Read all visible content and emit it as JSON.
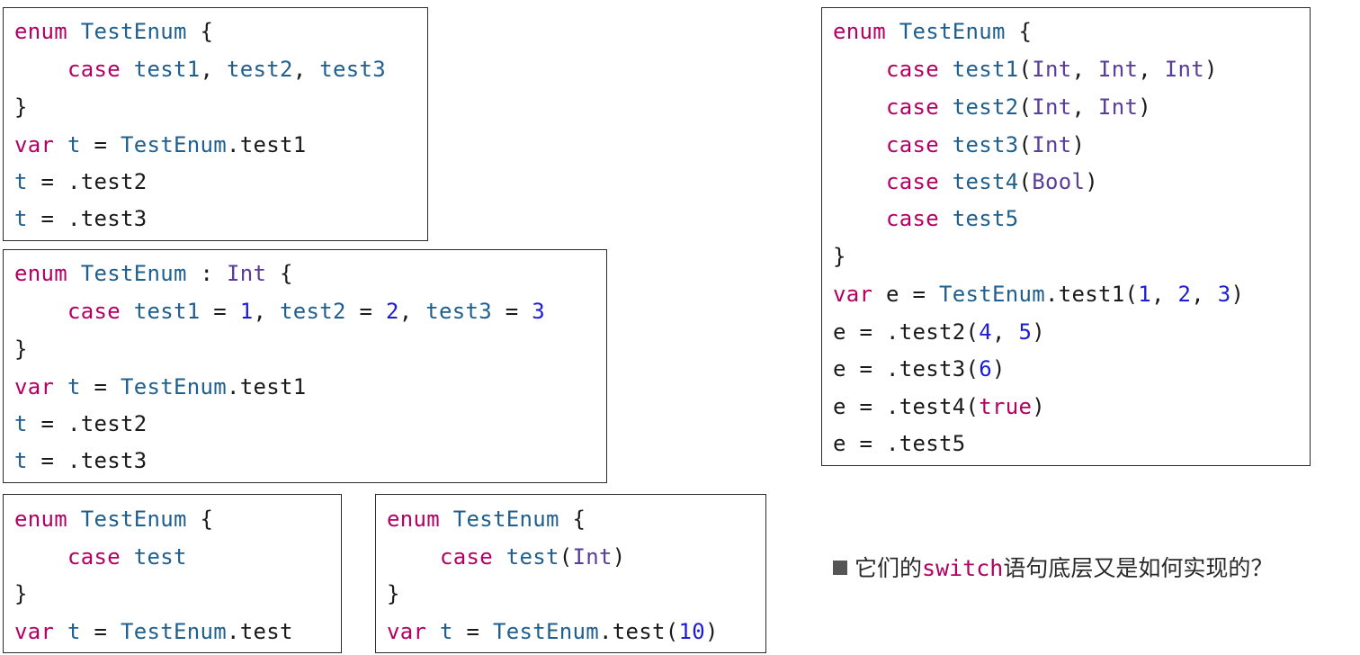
{
  "colors": {
    "keyword": "#b40062",
    "type": "#1f5f8f",
    "system_type": "#5a3c9a",
    "number": "#1c1cd6",
    "plain": "#1a1a1a",
    "border": "#2b2b2b"
  },
  "snippets": {
    "basic": {
      "lines": [
        [
          {
            "t": "enum",
            "c": "kw"
          },
          {
            "t": " "
          },
          {
            "t": "TestEnum",
            "c": "ty"
          },
          {
            "t": " {"
          }
        ],
        [
          {
            "t": "    "
          },
          {
            "t": "case",
            "c": "kw"
          },
          {
            "t": " "
          },
          {
            "t": "test1",
            "c": "ty"
          },
          {
            "t": ", "
          },
          {
            "t": "test2",
            "c": "ty"
          },
          {
            "t": ", "
          },
          {
            "t": "test3",
            "c": "ty"
          }
        ],
        [
          {
            "t": "}"
          }
        ],
        [
          {
            "t": "var",
            "c": "kw"
          },
          {
            "t": " "
          },
          {
            "t": "t",
            "c": "ty"
          },
          {
            "t": " = "
          },
          {
            "t": "TestEnum",
            "c": "ty"
          },
          {
            "t": ".test1"
          }
        ],
        [
          {
            "t": "t",
            "c": "ty"
          },
          {
            "t": " = .test2"
          }
        ],
        [
          {
            "t": "t",
            "c": "ty"
          },
          {
            "t": " = .test3"
          }
        ]
      ]
    },
    "raw_int": {
      "lines": [
        [
          {
            "t": "enum",
            "c": "kw"
          },
          {
            "t": " "
          },
          {
            "t": "TestEnum",
            "c": "ty"
          },
          {
            "t": " : "
          },
          {
            "t": "Int",
            "c": "sys"
          },
          {
            "t": " {"
          }
        ],
        [
          {
            "t": "    "
          },
          {
            "t": "case",
            "c": "kw"
          },
          {
            "t": " "
          },
          {
            "t": "test1",
            "c": "ty"
          },
          {
            "t": " = "
          },
          {
            "t": "1",
            "c": "num"
          },
          {
            "t": ", "
          },
          {
            "t": "test2",
            "c": "ty"
          },
          {
            "t": " = "
          },
          {
            "t": "2",
            "c": "num"
          },
          {
            "t": ", "
          },
          {
            "t": "test3",
            "c": "ty"
          },
          {
            "t": " = "
          },
          {
            "t": "3",
            "c": "num"
          }
        ],
        [
          {
            "t": "}"
          }
        ],
        [
          {
            "t": "var",
            "c": "kw"
          },
          {
            "t": " "
          },
          {
            "t": "t",
            "c": "ty"
          },
          {
            "t": " = "
          },
          {
            "t": "TestEnum",
            "c": "ty"
          },
          {
            "t": ".test1"
          }
        ],
        [
          {
            "t": "t",
            "c": "ty"
          },
          {
            "t": " = .test2"
          }
        ],
        [
          {
            "t": "t",
            "c": "ty"
          },
          {
            "t": " = .test3"
          }
        ]
      ]
    },
    "single": {
      "lines": [
        [
          {
            "t": "enum",
            "c": "kw"
          },
          {
            "t": " "
          },
          {
            "t": "TestEnum",
            "c": "ty"
          },
          {
            "t": " {"
          }
        ],
        [
          {
            "t": "    "
          },
          {
            "t": "case",
            "c": "kw"
          },
          {
            "t": " "
          },
          {
            "t": "test",
            "c": "ty"
          }
        ],
        [
          {
            "t": "}"
          }
        ],
        [
          {
            "t": "var",
            "c": "kw"
          },
          {
            "t": " "
          },
          {
            "t": "t",
            "c": "ty"
          },
          {
            "t": " = "
          },
          {
            "t": "TestEnum",
            "c": "ty"
          },
          {
            "t": ".test"
          }
        ]
      ]
    },
    "single_assoc": {
      "lines": [
        [
          {
            "t": "enum",
            "c": "kw"
          },
          {
            "t": " "
          },
          {
            "t": "TestEnum",
            "c": "ty"
          },
          {
            "t": " {"
          }
        ],
        [
          {
            "t": "    "
          },
          {
            "t": "case",
            "c": "kw"
          },
          {
            "t": " "
          },
          {
            "t": "test",
            "c": "ty"
          },
          {
            "t": "("
          },
          {
            "t": "Int",
            "c": "sys"
          },
          {
            "t": ")"
          }
        ],
        [
          {
            "t": "}"
          }
        ],
        [
          {
            "t": "var",
            "c": "kw"
          },
          {
            "t": " "
          },
          {
            "t": "t",
            "c": "ty"
          },
          {
            "t": " = "
          },
          {
            "t": "TestEnum",
            "c": "ty"
          },
          {
            "t": ".test("
          },
          {
            "t": "10",
            "c": "num"
          },
          {
            "t": ")"
          }
        ]
      ]
    },
    "associated": {
      "lines": [
        [
          {
            "t": "enum",
            "c": "kw"
          },
          {
            "t": " "
          },
          {
            "t": "TestEnum",
            "c": "ty"
          },
          {
            "t": " {"
          }
        ],
        [
          {
            "t": "    "
          },
          {
            "t": "case",
            "c": "kw"
          },
          {
            "t": " "
          },
          {
            "t": "test1",
            "c": "ty"
          },
          {
            "t": "("
          },
          {
            "t": "Int",
            "c": "sys"
          },
          {
            "t": ", "
          },
          {
            "t": "Int",
            "c": "sys"
          },
          {
            "t": ", "
          },
          {
            "t": "Int",
            "c": "sys"
          },
          {
            "t": ")"
          }
        ],
        [
          {
            "t": "    "
          },
          {
            "t": "case",
            "c": "kw"
          },
          {
            "t": " "
          },
          {
            "t": "test2",
            "c": "ty"
          },
          {
            "t": "("
          },
          {
            "t": "Int",
            "c": "sys"
          },
          {
            "t": ", "
          },
          {
            "t": "Int",
            "c": "sys"
          },
          {
            "t": ")"
          }
        ],
        [
          {
            "t": "    "
          },
          {
            "t": "case",
            "c": "kw"
          },
          {
            "t": " "
          },
          {
            "t": "test3",
            "c": "ty"
          },
          {
            "t": "("
          },
          {
            "t": "Int",
            "c": "sys"
          },
          {
            "t": ")"
          }
        ],
        [
          {
            "t": "    "
          },
          {
            "t": "case",
            "c": "kw"
          },
          {
            "t": " "
          },
          {
            "t": "test4",
            "c": "ty"
          },
          {
            "t": "("
          },
          {
            "t": "Bool",
            "c": "sys"
          },
          {
            "t": ")"
          }
        ],
        [
          {
            "t": "    "
          },
          {
            "t": "case",
            "c": "kw"
          },
          {
            "t": " "
          },
          {
            "t": "test5",
            "c": "ty"
          }
        ],
        [
          {
            "t": "}"
          }
        ],
        [
          {
            "t": "var",
            "c": "kw"
          },
          {
            "t": " e = "
          },
          {
            "t": "TestEnum",
            "c": "ty"
          },
          {
            "t": ".test1("
          },
          {
            "t": "1",
            "c": "num"
          },
          {
            "t": ", "
          },
          {
            "t": "2",
            "c": "num"
          },
          {
            "t": ", "
          },
          {
            "t": "3",
            "c": "num"
          },
          {
            "t": ")"
          }
        ],
        [
          {
            "t": "e = .test2("
          },
          {
            "t": "4",
            "c": "num"
          },
          {
            "t": ", "
          },
          {
            "t": "5",
            "c": "num"
          },
          {
            "t": ")"
          }
        ],
        [
          {
            "t": "e = .test3("
          },
          {
            "t": "6",
            "c": "num"
          },
          {
            "t": ")"
          }
        ],
        [
          {
            "t": "e = .test4("
          },
          {
            "t": "true",
            "c": "kw"
          },
          {
            "t": ")"
          }
        ],
        [
          {
            "t": "e = .test5"
          }
        ]
      ]
    }
  },
  "note": {
    "prefix": "它们的",
    "highlight": "switch",
    "suffix": "语句底层又是如何实现的？"
  }
}
